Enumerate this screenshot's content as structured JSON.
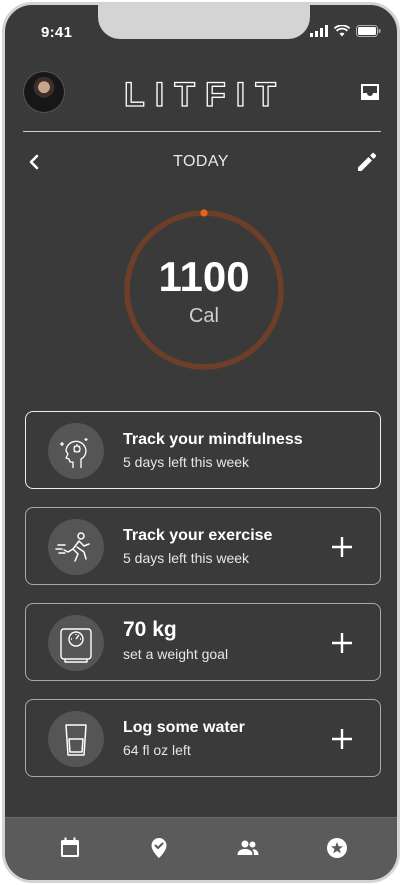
{
  "status_bar": {
    "time": "9:41"
  },
  "header": {
    "logo_text": "LITFIT"
  },
  "date_nav": {
    "label": "TODAY"
  },
  "calories": {
    "value": "1100",
    "unit": "Cal",
    "progress": 0.0
  },
  "cards": [
    {
      "title": "Track your mindfulness",
      "subtitle": "5 days left this week",
      "icon": "mindfulness-icon",
      "has_add": false
    },
    {
      "title": "Track your exercise",
      "subtitle": "5 days left this week",
      "icon": "exercise-icon",
      "has_add": true
    },
    {
      "title": "70 kg",
      "subtitle": "set a weight goal",
      "icon": "scale-icon",
      "has_add": true
    },
    {
      "title": "Log some water",
      "subtitle": "64 fl oz left",
      "icon": "water-glass-icon",
      "has_add": true
    }
  ],
  "tab_bar": {
    "items": [
      "calendar-icon",
      "location-check-icon",
      "people-icon",
      "star-badge-icon"
    ]
  },
  "colors": {
    "background": "#3a3a3a",
    "ring": "#6e3f28",
    "ring_marker": "#e8631a",
    "tabbar": "#5b5b5b"
  }
}
